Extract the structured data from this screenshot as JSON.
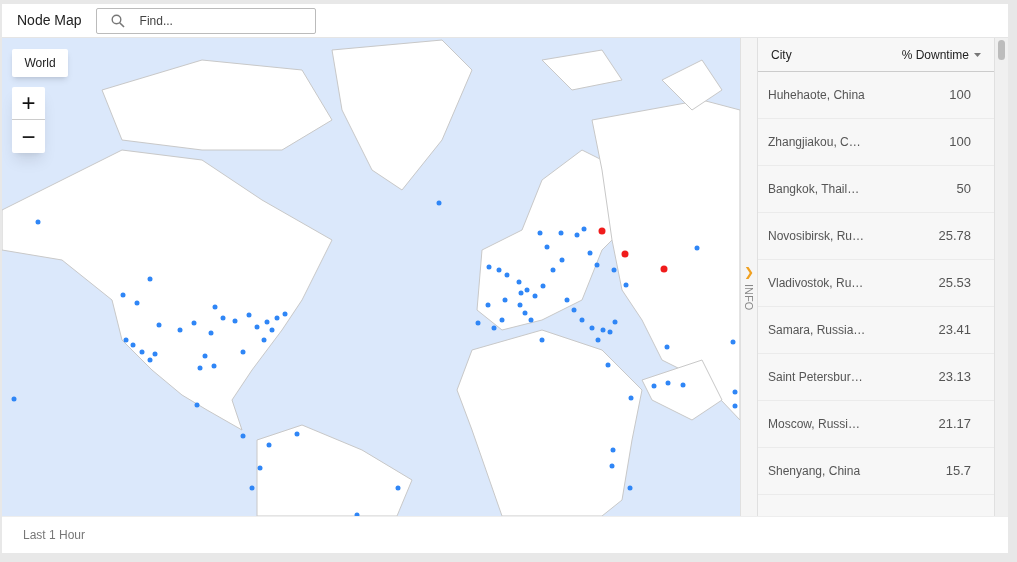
{
  "header": {
    "title": "Node Map",
    "search": {
      "placeholder": "Find..."
    }
  },
  "map": {
    "kind": "picture",
    "region_button": "World",
    "zoom_in": "+",
    "zoom_out": "−"
  },
  "info_tab": {
    "label": "INFO",
    "expander": "❯"
  },
  "table": {
    "columns": [
      {
        "label": "City",
        "sorted": false
      },
      {
        "label": "% Downtime",
        "sorted": true
      }
    ],
    "rows": [
      {
        "city": "Huhehaote, China",
        "downtime": "100"
      },
      {
        "city": "Zhangjiakou, C…",
        "downtime": "100"
      },
      {
        "city": "Bangkok, Thail…",
        "downtime": "50"
      },
      {
        "city": "Novosibirsk, Ru…",
        "downtime": "25.78"
      },
      {
        "city": "Vladivostok, Ru…",
        "downtime": "25.53"
      },
      {
        "city": "Samara, Russia…",
        "downtime": "23.41"
      },
      {
        "city": "Saint Petersbur…",
        "downtime": "23.13"
      },
      {
        "city": "Moscow, Russi…",
        "downtime": "21.17"
      },
      {
        "city": "Shenyang, China",
        "downtime": "15.7"
      }
    ]
  },
  "footer": {
    "time_range": "Last 1 Hour"
  }
}
